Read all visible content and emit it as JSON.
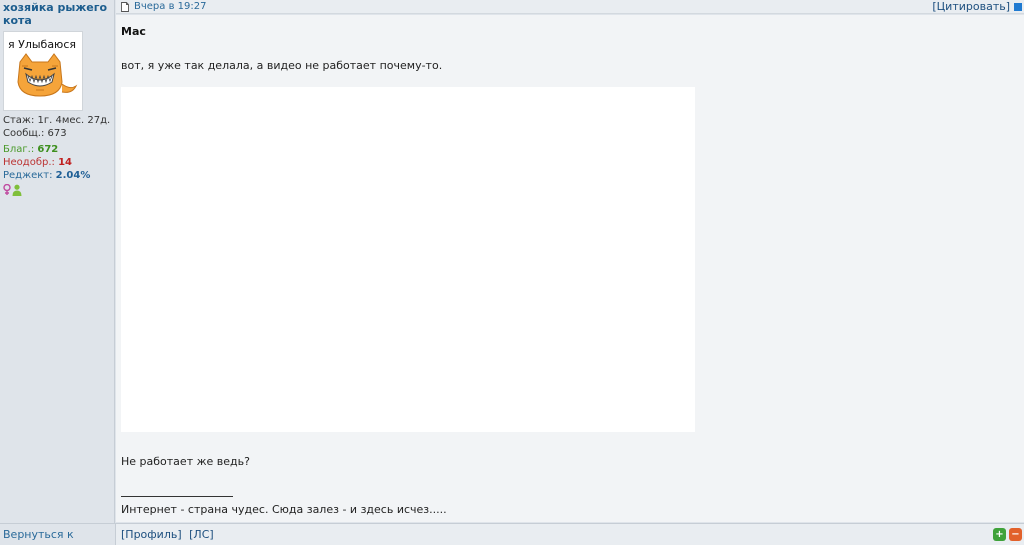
{
  "author": {
    "name": "хозяйка рыжего кота",
    "avatar_caption": "я Улыбаюся",
    "stats": {
      "tenure": "Стаж: 1г. 4мес. 27д.",
      "messages": "Сообщ.: 673",
      "thanks_label": "Благ.: ",
      "thanks_value": "672",
      "disapproved_label": "Неодобр.: ",
      "disapproved_value": "14",
      "reject_label": "Реджект: ",
      "reject_value": "2.04%"
    }
  },
  "post": {
    "date": "Вчера в 19:27",
    "quote_label": "[Цитировать]",
    "title": "Mac",
    "text": "вот, я уже так делала, а видео не работает почему-то.",
    "text_after": "Не работает же ведь?",
    "signature_line": "_______________",
    "signature": "Интернет - страна чудес. Сюда залез - и здесь исчез....."
  },
  "footer": {
    "back_to_top": "Вернуться к началу",
    "profile": "[Профиль]",
    "pm": "[ЛС]"
  },
  "colors": {
    "accent": "#1f5f96",
    "thanks": "#3d8f1e",
    "disapproved": "#c02020",
    "vote_up": "#3fa23a",
    "vote_down": "#e2612b"
  },
  "icons": [
    "document-icon",
    "quote-square-icon",
    "female-icon",
    "user-icon",
    "thumbs-up-icon",
    "thumbs-down-icon"
  ]
}
